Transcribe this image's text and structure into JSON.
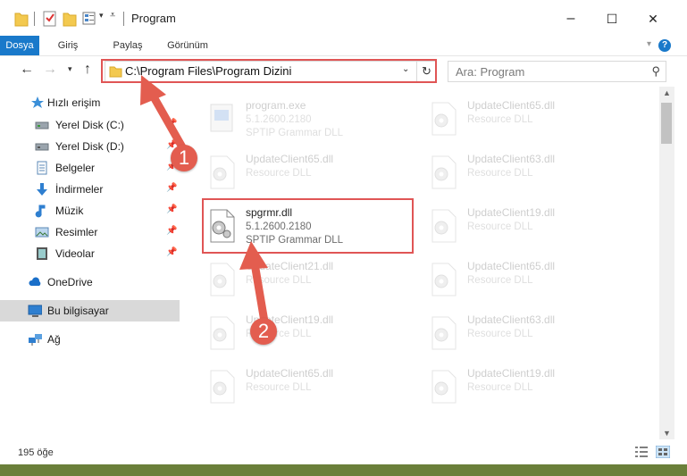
{
  "window": {
    "title": "Program",
    "controls": {
      "minimize": "–",
      "maximize": "☐",
      "close": "✕"
    }
  },
  "ribbon": {
    "tabs": [
      "Dosya",
      "Giriş",
      "Paylaş",
      "Görünüm"
    ],
    "active_tab": "Dosya",
    "help": "?"
  },
  "address_bar": {
    "path": "C:\\Program Files\\Program Dizini"
  },
  "search": {
    "placeholder": "Ara: Program"
  },
  "sidebar": {
    "items": [
      {
        "label": "Hızlı erişim",
        "icon": "star-icon"
      },
      {
        "label": "Yerel Disk (C:)",
        "icon": "drive-icon",
        "pinned": true
      },
      {
        "label": "Yerel Disk (D:)",
        "icon": "drive-icon",
        "pinned": true
      },
      {
        "label": "Belgeler",
        "icon": "documents-icon",
        "pinned": true
      },
      {
        "label": "İndirmeler",
        "icon": "download-icon",
        "pinned": true
      },
      {
        "label": "Müzik",
        "icon": "music-icon",
        "pinned": true
      },
      {
        "label": "Resimler",
        "icon": "pictures-icon",
        "pinned": true
      },
      {
        "label": "Videolar",
        "icon": "video-icon",
        "pinned": true
      },
      {
        "label": "OneDrive",
        "icon": "cloud-icon"
      },
      {
        "label": "Bu bilgisayar",
        "icon": "computer-icon",
        "selected": true
      },
      {
        "label": "Ağ",
        "icon": "network-icon"
      }
    ]
  },
  "files": {
    "left": [
      {
        "name": "program.exe",
        "line2": "5.1.2600.2180",
        "line3": "SPTIP Grammar DLL",
        "faded": true,
        "icon": "exe-icon"
      },
      {
        "name": "UpdateClient65.dll",
        "line2": "Resource DLL",
        "faded": true,
        "icon": "dll-icon"
      },
      {
        "name": "spgrmr.dll",
        "line2": "5.1.2600.2180",
        "line3": "SPTIP Grammar DLL",
        "faded": false,
        "icon": "dll-icon"
      },
      {
        "name": "UpdateClient21.dll",
        "line2": "Resource DLL",
        "faded": true,
        "icon": "dll-icon"
      },
      {
        "name": "UpdateClient19.dll",
        "line2": "Resource DLL",
        "faded": true,
        "icon": "dll-icon"
      },
      {
        "name": "UpdateClient65.dll",
        "line2": "Resource DLL",
        "faded": true,
        "icon": "dll-icon"
      }
    ],
    "right": [
      {
        "name": "UpdateClient65.dll",
        "line2": "Resource DLL",
        "faded": true,
        "icon": "dll-icon"
      },
      {
        "name": "UpdateClient63.dll",
        "line2": "Resource DLL",
        "faded": true,
        "icon": "dll-icon"
      },
      {
        "name": "UpdateClient19.dll",
        "line2": "Resource DLL",
        "faded": true,
        "icon": "dll-icon"
      },
      {
        "name": "UpdateClient65.dll",
        "line2": "Resource DLL",
        "faded": true,
        "icon": "dll-icon"
      },
      {
        "name": "UpdateClient63.dll",
        "line2": "Resource DLL",
        "faded": true,
        "icon": "dll-icon"
      },
      {
        "name": "UpdateClient19.dll",
        "line2": "Resource DLL",
        "faded": true,
        "icon": "dll-icon"
      }
    ]
  },
  "status": {
    "count": "195 öğe"
  },
  "annotations": {
    "step1": "1",
    "step2": "2",
    "color": "#e35d4f"
  },
  "colors": {
    "accent": "#1979ca",
    "highlight_box": "#e05555",
    "selected_bg": "#d9d9d9"
  }
}
